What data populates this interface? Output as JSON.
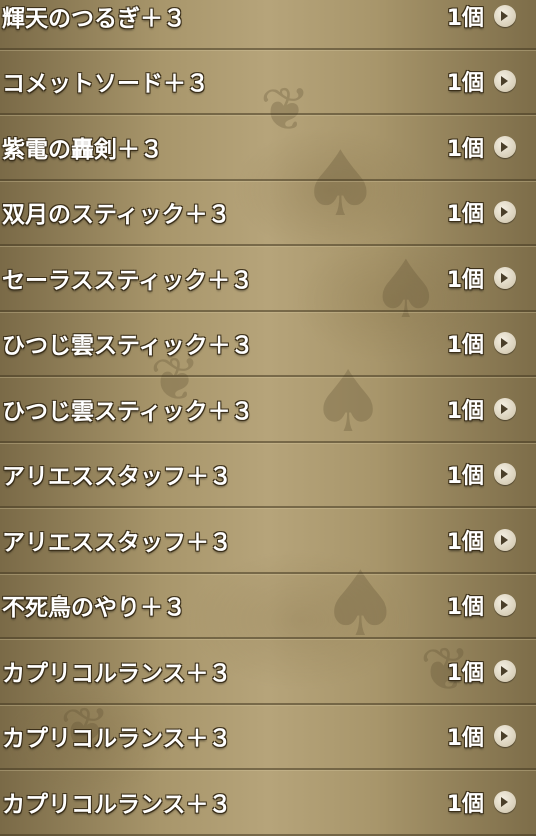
{
  "items": [
    {
      "name": "輝天のつるぎ＋３",
      "count": "1個",
      "icon": "chevron-right-icon"
    },
    {
      "name": "コメットソード＋３",
      "count": "1個",
      "icon": "chevron-right-icon"
    },
    {
      "name": "紫電の轟剣＋３",
      "count": "1個",
      "icon": "chevron-right-icon"
    },
    {
      "name": "双月のスティック＋３",
      "count": "1個",
      "icon": "chevron-right-icon"
    },
    {
      "name": "セーラススティック＋３",
      "count": "1個",
      "icon": "chevron-right-icon"
    },
    {
      "name": "ひつじ雲スティック＋３",
      "count": "1個",
      "icon": "chevron-right-icon"
    },
    {
      "name": "ひつじ雲スティック＋３",
      "count": "1個",
      "icon": "chevron-right-icon"
    },
    {
      "name": "アリエススタッフ＋３",
      "count": "1個",
      "icon": "chevron-right-icon"
    },
    {
      "name": "アリエススタッフ＋３",
      "count": "1個",
      "icon": "chevron-right-icon"
    },
    {
      "name": "不死鳥のやり＋３",
      "count": "1個",
      "icon": "chevron-right-icon"
    },
    {
      "name": "カプリコルランス＋３",
      "count": "1個",
      "icon": "chevron-right-icon"
    },
    {
      "name": "カプリコルランス＋３",
      "count": "1個",
      "icon": "chevron-right-icon"
    },
    {
      "name": "カプリコルランス＋３",
      "count": "1個",
      "icon": "chevron-right-icon"
    }
  ]
}
